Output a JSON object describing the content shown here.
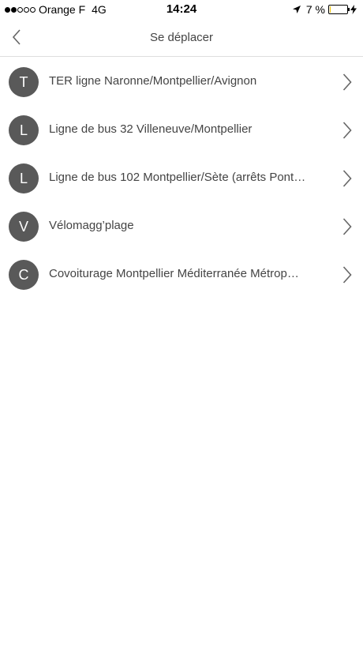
{
  "status_bar": {
    "carrier": "Orange F",
    "network": "4G",
    "time": "14:24",
    "battery": "7 %",
    "battery_level": 0.07,
    "signal_bars_filled": 2,
    "signal_bars_total": 5
  },
  "nav": {
    "title": "Se déplacer",
    "back_icon": "chevron-left-icon"
  },
  "items": [
    {
      "initial": "T",
      "label": "TER ligne Naronne/Montpellier/Avignon"
    },
    {
      "initial": "L",
      "label": "Ligne de bus 32 Villeneuve/Montpellier"
    },
    {
      "initial": "L",
      "label": "Ligne de bus 102 Montpellier/Sète (arrêts Pont…"
    },
    {
      "initial": "V",
      "label": "Vélomagg’plage"
    },
    {
      "initial": "C",
      "label": "Covoiturage Montpellier Méditerranée Métrop…"
    }
  ],
  "colors": {
    "avatar_bg": "#595959",
    "divider": "#dedede",
    "battery_fill": "#f0c400"
  }
}
